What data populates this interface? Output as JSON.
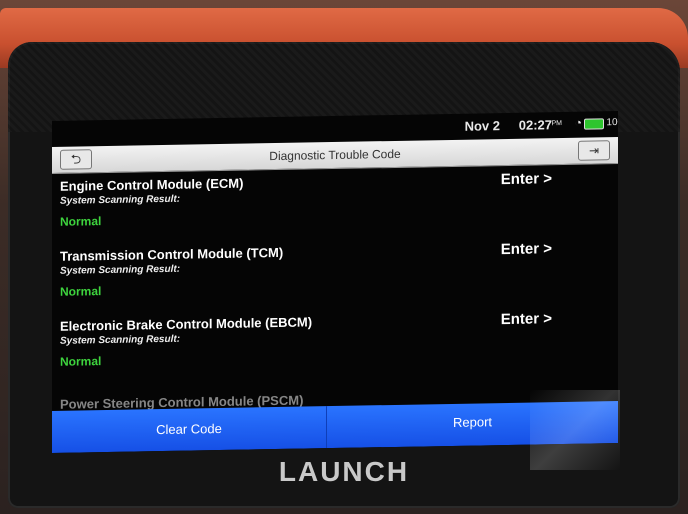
{
  "status_bar": {
    "date": "Nov 2",
    "time": "02:27",
    "ampm": "PM",
    "battery": "100%"
  },
  "header": {
    "back_icon": "back-arrow-icon",
    "title": "Diagnostic Trouble Code",
    "exit_icon": "exit-icon"
  },
  "modules": [
    {
      "name": "Engine Control Module (ECM)",
      "scan_label": "System Scanning Result:",
      "result": "Normal",
      "enter_label": "Enter >"
    },
    {
      "name": "Transmission Control Module (TCM)",
      "scan_label": "System Scanning Result:",
      "result": "Normal",
      "enter_label": "Enter >"
    },
    {
      "name": "Electronic Brake Control Module (EBCM)",
      "scan_label": "System Scanning Result:",
      "result": "Normal",
      "enter_label": "Enter >"
    }
  ],
  "partial_module": "Power Steering Control Module (PSCM)",
  "footer": {
    "clear_code": "Clear Code",
    "report": "Report"
  },
  "brand": "LAUNCH",
  "colors": {
    "accent": "#1e5cf0",
    "result_ok": "#3ed43e",
    "battery": "#2ec52e"
  }
}
